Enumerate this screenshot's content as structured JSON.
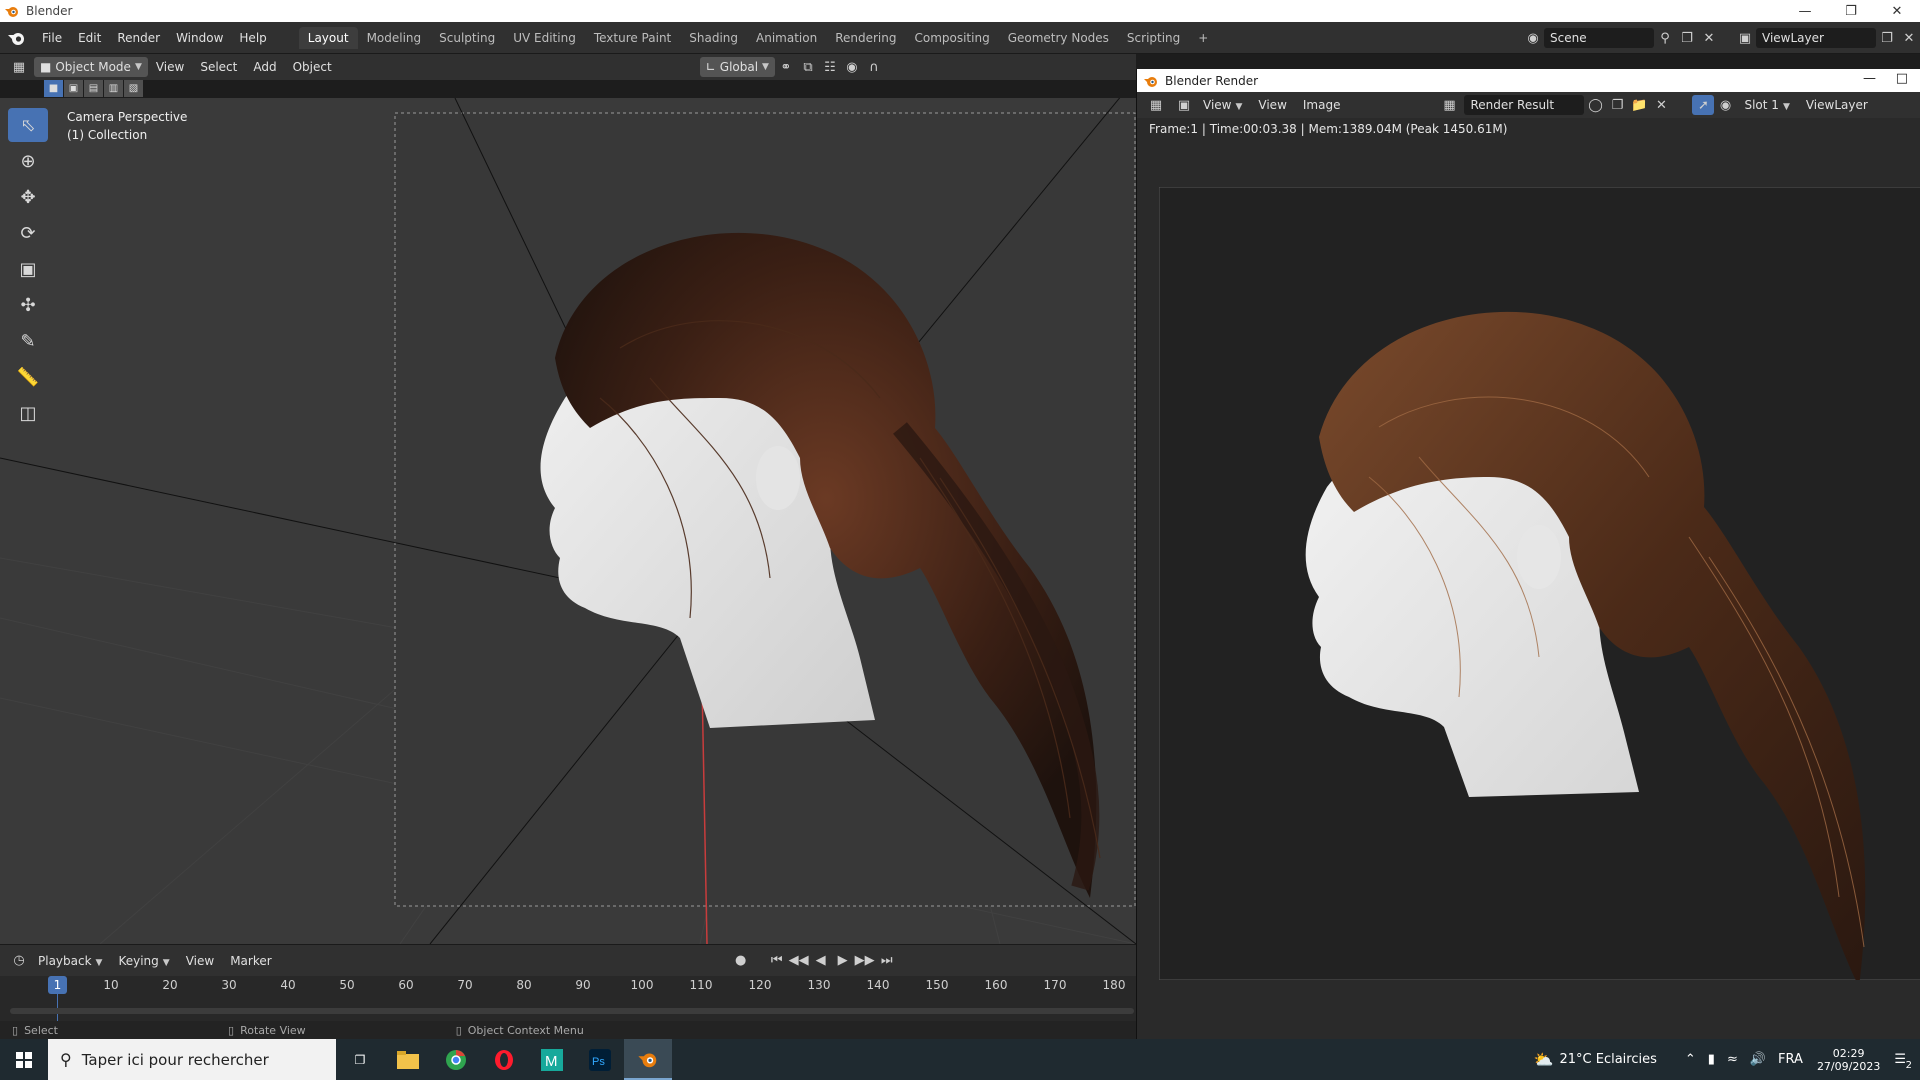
{
  "window": {
    "title": "Blender"
  },
  "menu": [
    "File",
    "Edit",
    "Render",
    "Window",
    "Help"
  ],
  "workspaces": [
    "Layout",
    "Modeling",
    "Sculpting",
    "UV Editing",
    "Texture Paint",
    "Shading",
    "Animation",
    "Rendering",
    "Compositing",
    "Geometry Nodes",
    "Scripting"
  ],
  "active_workspace": "Layout",
  "scene": {
    "name": "Scene",
    "view_layer": "ViewLayer"
  },
  "viewport_header": {
    "mode": "Object Mode",
    "menus": [
      "View",
      "Select",
      "Add",
      "Object"
    ],
    "orientation": "Global"
  },
  "viewport": {
    "overlay_line1": "Camera Perspective",
    "overlay_line2": "(1) Collection"
  },
  "timeline": {
    "menus": [
      "Playback",
      "Keying",
      "View",
      "Marker"
    ],
    "current_frame": "1",
    "frames": [
      "10",
      "20",
      "30",
      "40",
      "50",
      "60",
      "70",
      "80",
      "90",
      "100",
      "110",
      "120",
      "130",
      "140",
      "150",
      "160",
      "170",
      "180"
    ]
  },
  "status": {
    "select": "Select",
    "rotate": "Rotate View",
    "context": "Object Context Menu"
  },
  "render_window": {
    "title": "Blender Render",
    "menus": [
      "View",
      "View",
      "Image"
    ],
    "image_name": "Render Result",
    "slot": "Slot 1",
    "view_layer": "ViewLayer",
    "info": "Frame:1 | Time:00:03.38 | Mem:1389.04M (Peak 1450.61M)"
  },
  "taskbar": {
    "search_placeholder": "Taper ici pour rechercher",
    "weather": "21°C  Eclaircies",
    "lang": "FRA",
    "time": "02:29",
    "date": "27/09/2023",
    "notifications": "2"
  },
  "colors": {
    "accent": "#4772b3",
    "blender_orange": "#e87d0d",
    "render_bg": "#222222"
  }
}
